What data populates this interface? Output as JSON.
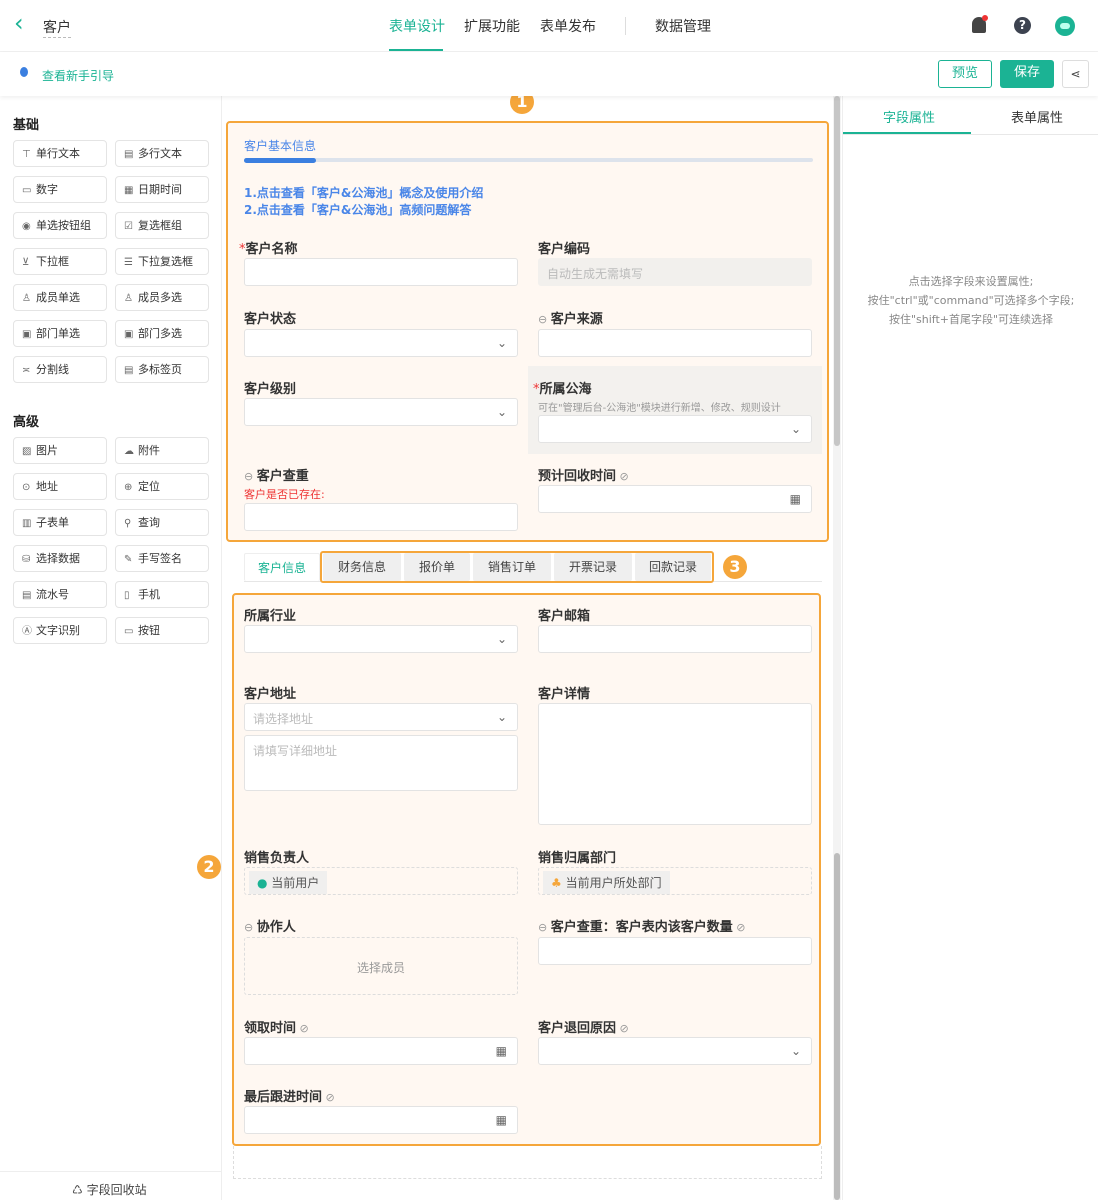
{
  "header": {
    "back_label": "客户",
    "nav": [
      "表单设计",
      "扩展功能",
      "表单发布",
      "数据管理"
    ],
    "active_nav": 0
  },
  "subbar": {
    "guide_link": "查看新手引导",
    "preview": "预览",
    "save": "保存"
  },
  "colors": {
    "accent": "#1bb394",
    "highlight": "#f5a63a",
    "link": "#4a86e8"
  },
  "sidebar": {
    "basic_title": "基础",
    "basic": [
      {
        "icon": "text-icon",
        "g": "⊤",
        "label": "单行文本"
      },
      {
        "icon": "multiline-text-icon",
        "g": "▤",
        "label": "多行文本"
      },
      {
        "icon": "number-icon",
        "g": "▭",
        "label": "数字"
      },
      {
        "icon": "calendar-icon",
        "g": "▦",
        "label": "日期时间"
      },
      {
        "icon": "radio-icon",
        "g": "◉",
        "label": "单选按钮组"
      },
      {
        "icon": "checkbox-icon",
        "g": "☑",
        "label": "复选框组"
      },
      {
        "icon": "dropdown-icon",
        "g": "⊻",
        "label": "下拉框"
      },
      {
        "icon": "multi-dropdown-icon",
        "g": "☰",
        "label": "下拉复选框"
      },
      {
        "icon": "member-icon",
        "g": "♙",
        "label": "成员单选"
      },
      {
        "icon": "members-icon",
        "g": "♙",
        "label": "成员多选"
      },
      {
        "icon": "department-icon",
        "g": "▣",
        "label": "部门单选"
      },
      {
        "icon": "departments-icon",
        "g": "▣",
        "label": "部门多选"
      },
      {
        "icon": "divider-icon",
        "g": "≍",
        "label": "分割线"
      },
      {
        "icon": "tabs-icon",
        "g": "▤",
        "label": "多标签页"
      }
    ],
    "advanced_title": "高级",
    "advanced": [
      {
        "icon": "image-icon",
        "g": "▨",
        "label": "图片"
      },
      {
        "icon": "attachment-icon",
        "g": "☁",
        "label": "附件"
      },
      {
        "icon": "address-icon",
        "g": "⊙",
        "label": "地址"
      },
      {
        "icon": "location-icon",
        "g": "⊕",
        "label": "定位"
      },
      {
        "icon": "subform-icon",
        "g": "▥",
        "label": "子表单"
      },
      {
        "icon": "query-icon",
        "g": "⚲",
        "label": "查询"
      },
      {
        "icon": "select-data-icon",
        "g": "⛁",
        "label": "选择数据"
      },
      {
        "icon": "signature-icon",
        "g": "✎",
        "label": "手写签名"
      },
      {
        "icon": "serial-number-icon",
        "g": "▤",
        "label": "流水号"
      },
      {
        "icon": "phone-icon",
        "g": "▯",
        "label": "手机"
      },
      {
        "icon": "ocr-icon",
        "g": "Ⓐ",
        "label": "文字识别"
      },
      {
        "icon": "button-icon",
        "g": "▭",
        "label": "按钮"
      }
    ],
    "recycle": "字段回收站"
  },
  "form": {
    "section_title": "客户基本信息",
    "links": [
      "1.点击查看「客户&公海池」概念及使用介绍",
      "2.点击查看「客户&公海池」高频问题解答"
    ],
    "badges": [
      "1",
      "2",
      "3"
    ],
    "fields": [
      {
        "label": "客户名称",
        "required": true,
        "type": "input"
      },
      {
        "label": "客户编码",
        "type": "disabled",
        "placeholder": "自动生成无需填写"
      },
      {
        "label": "客户状态",
        "type": "select"
      },
      {
        "label": "客户来源",
        "link": true,
        "type": "input"
      },
      {
        "label": "客户级别",
        "type": "select"
      },
      {
        "label": "所属公海",
        "required": true,
        "type": "select",
        "hint": "可在\"管理后台-公海池\"模块进行新增、修改、规则设计"
      },
      {
        "label": "客户查重",
        "link": true,
        "type": "input",
        "note": "客户是否已存在:"
      },
      {
        "label": "预计回收时间",
        "hidden": true,
        "type": "date"
      },
      {
        "label": "所属行业",
        "type": "select"
      },
      {
        "label": "客户邮箱",
        "type": "input"
      },
      {
        "label": "客户地址",
        "type": "select",
        "placeholder": "请选择地址",
        "extra_placeholder": "请填写详细地址"
      },
      {
        "label": "客户详情",
        "type": "textarea"
      },
      {
        "label": "销售负责人",
        "type": "chip",
        "chip": "当前用户",
        "chip_icon": "user-icon"
      },
      {
        "label": "销售归属部门",
        "type": "chip",
        "chip": "当前用户所处部门",
        "chip_icon": "org-icon"
      },
      {
        "label": "协作人",
        "link": true,
        "type": "dashtext",
        "placeholder": "选择成员"
      },
      {
        "label": "客户查重：客户表内该客户数量",
        "link": true,
        "hidden": true,
        "type": "input"
      },
      {
        "label": "领取时间",
        "hidden": true,
        "type": "date"
      },
      {
        "label": "客户退回原因",
        "hidden": true,
        "type": "select"
      },
      {
        "label": "最后跟进时间",
        "hidden": true,
        "type": "date"
      }
    ],
    "tabs": [
      "客户信息",
      "财务信息",
      "报价单",
      "销售订单",
      "开票记录",
      "回款记录"
    ]
  },
  "right_panel": {
    "tabs": [
      "字段属性",
      "表单属性"
    ],
    "hint": [
      "点击选择字段来设置属性;",
      "按住\"ctrl\"或\"command\"可选择多个字段;",
      "按住\"shift+首尾字段\"可连续选择"
    ]
  }
}
